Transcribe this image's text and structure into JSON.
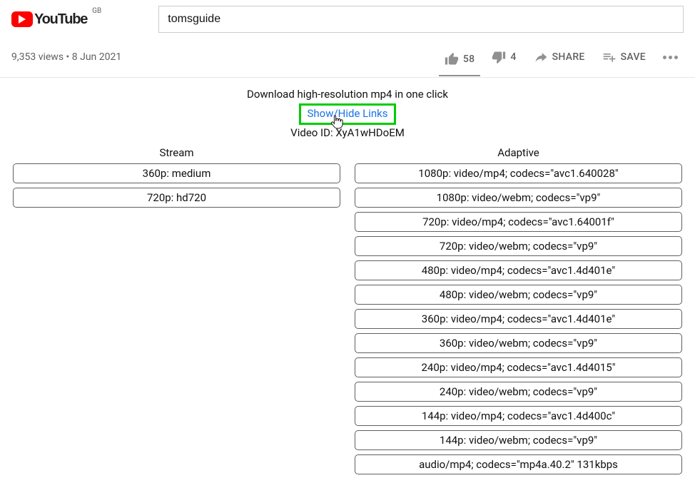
{
  "header": {
    "logo_text": "YouTube",
    "country": "GB",
    "search_value": "tomsguide"
  },
  "meta": {
    "views": "9,353 views",
    "date": "8 Jun 2021",
    "likes": "58",
    "dislikes": "4",
    "share": "SHARE",
    "save": "SAVE"
  },
  "download": {
    "heading": "Download high-resolution mp4 in one click",
    "toggle": "Show/Hide Links",
    "video_id_label": "Video ID:",
    "video_id": "XyA1wHDoEM"
  },
  "columns": {
    "stream": {
      "header": "Stream",
      "items": [
        "360p: medium",
        "720p: hd720"
      ]
    },
    "adaptive": {
      "header": "Adaptive",
      "items": [
        "1080p: video/mp4; codecs=\"avc1.640028\"",
        "1080p: video/webm; codecs=\"vp9\"",
        "720p: video/mp4; codecs=\"avc1.64001f\"",
        "720p: video/webm; codecs=\"vp9\"",
        "480p: video/mp4; codecs=\"avc1.4d401e\"",
        "480p: video/webm; codecs=\"vp9\"",
        "360p: video/mp4; codecs=\"avc1.4d401e\"",
        "360p: video/webm; codecs=\"vp9\"",
        "240p: video/mp4; codecs=\"avc1.4d4015\"",
        "240p: video/webm; codecs=\"vp9\"",
        "144p: video/mp4; codecs=\"avc1.4d400c\"",
        "144p: video/webm; codecs=\"vp9\"",
        "audio/mp4; codecs=\"mp4a.40.2\" 131kbps"
      ]
    }
  }
}
